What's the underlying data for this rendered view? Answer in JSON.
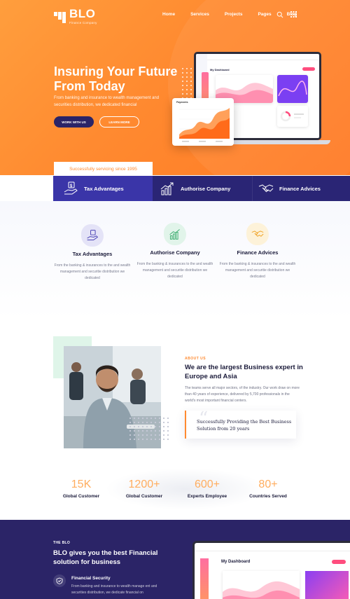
{
  "brand": {
    "name": "BLO",
    "tagline": "Finance Company"
  },
  "nav": {
    "items": [
      "Home",
      "Services",
      "Projects",
      "Pages",
      "Blog"
    ],
    "search_icon": "search-icon",
    "menu_icon": "grid-menu-icon"
  },
  "hero": {
    "title": "Insuring Your Future From Today",
    "subtitle": "From banking and insurance to wealth management and securities distribution, we dedicated financial",
    "primary_button": "WORK WITH US",
    "secondary_button": "LEARN MORE",
    "dashboard": {
      "title": "My Dashboard",
      "card_title": "Payments"
    }
  },
  "servicing_badge": "Successfully servicing since 1995",
  "tabs": [
    {
      "label": "Tax Advantages",
      "icon": "money-hand-icon"
    },
    {
      "label": "Authorise Company",
      "icon": "growth-chart-icon"
    },
    {
      "label": "Finance Advices",
      "icon": "handshake-icon"
    }
  ],
  "features": [
    {
      "title": "Tax Advantages",
      "text": "From the banking & insurances to the and wealth management and securitie distribution we dedicated",
      "icon": "money-hand-icon"
    },
    {
      "title": "Authorise Company",
      "text": "From the banking & insurances to the and wealth management and securitie distribution we dedicated",
      "icon": "growth-chart-icon"
    },
    {
      "title": "Finance Advices",
      "text": "From the banking & insurances to the and wealth management and securitie distribution we dedicated",
      "icon": "handshake-icon"
    }
  ],
  "about": {
    "label": "ABOUT US",
    "title": "We are the largest Business expert in Europe and Asia",
    "text": "The teams serve all major sectors, of the industry. Our work draw on more than 40 years of experience, delivered by 5,700 professionals in the world's most important financial centers.",
    "quote": "Successfully Providing the Best Business Solution from 20 years"
  },
  "stats": [
    {
      "value": "15K",
      "label": "Global Customer"
    },
    {
      "value": "1200+",
      "label": "Global Customer"
    },
    {
      "value": "600+",
      "label": "Experts Employee"
    },
    {
      "value": "80+",
      "label": "Countries Served"
    }
  ],
  "bottom": {
    "label": "THE BLO",
    "title": "BLO gives you the best Financial solution for business",
    "feature_title": "Financial Security",
    "feature_text": "From banking and insurance to wealth manage ent and securities distribution, we dedicate financial on",
    "dashboard_title": "My Dashboard"
  },
  "colors": {
    "orange": "#ff8a30",
    "navy": "#2b2467",
    "tab_active": "#3a35a8",
    "stat": "#ffad5f"
  }
}
